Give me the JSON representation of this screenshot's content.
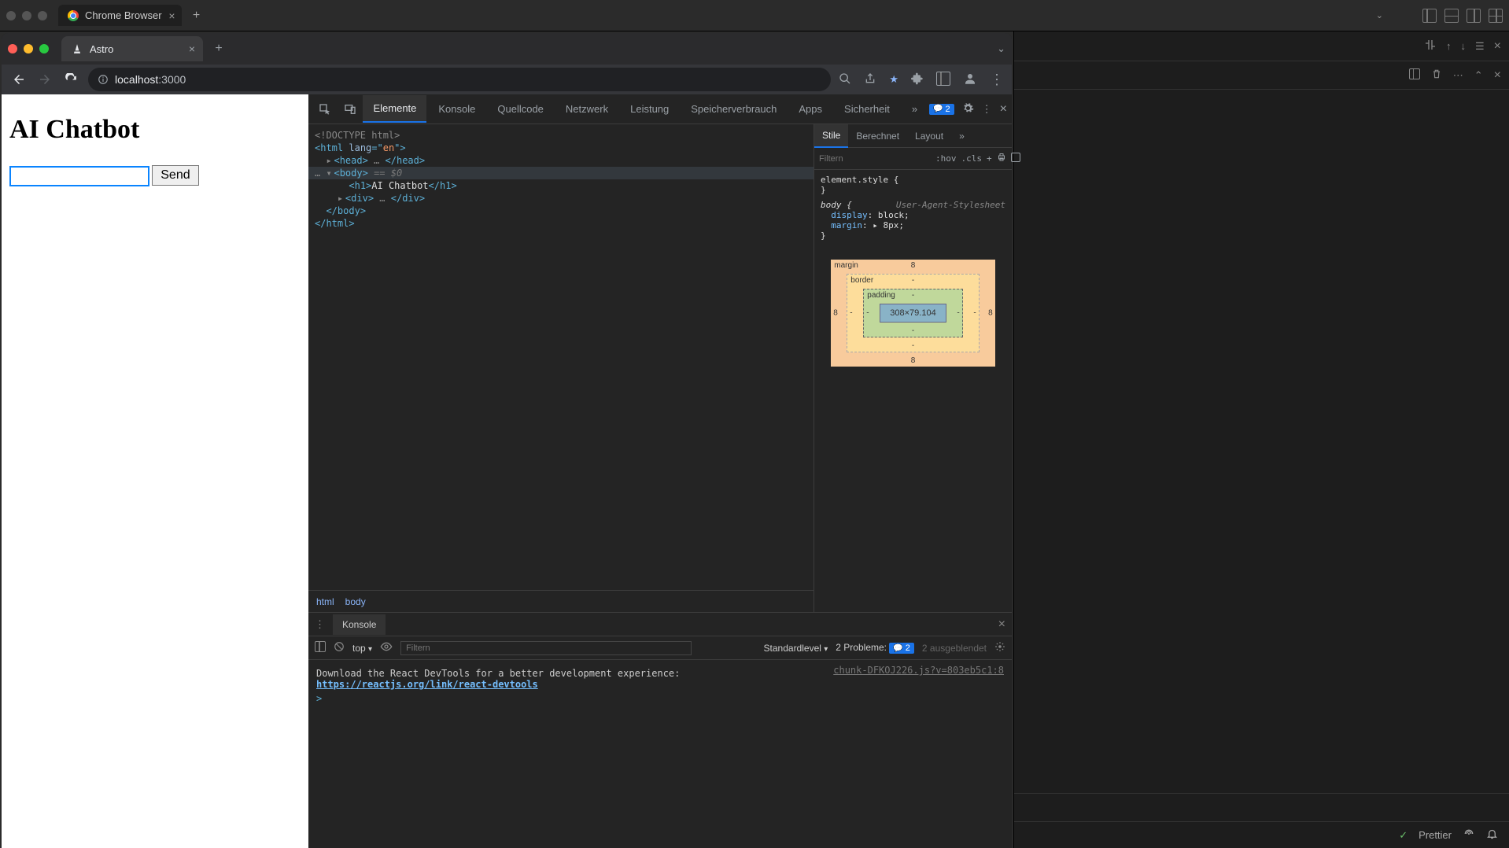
{
  "outer": {
    "tab_title": "Chrome Browser",
    "new_tab": "+",
    "dropdown": "⌄"
  },
  "chrome": {
    "tab_title": "Astro",
    "new_tab": "+",
    "url_host": "localhost",
    "url_path": ":3000"
  },
  "page": {
    "heading": "AI Chatbot",
    "input_value": "",
    "send_button": "Send"
  },
  "devtools": {
    "tabs": [
      "Elemente",
      "Konsole",
      "Quellcode",
      "Netzwerk",
      "Leistung",
      "Speicherverbrauch",
      "Apps",
      "Sicherheit"
    ],
    "more": "»",
    "issues_badge": "2",
    "dom": {
      "l1": "<!DOCTYPE html>",
      "l2a": "<",
      "l2b": "html",
      "l2c": " lang",
      "l2d": "=\"",
      "l2e": "en",
      "l2f": "\">",
      "l3a": "<",
      "l3b": "head",
      "l3c": ">",
      "l3d": " … ",
      "l3e": "</",
      "l3f": "head",
      "l3g": ">",
      "l4a": "<",
      "l4b": "body",
      "l4c": ">",
      "l4d": " == $0",
      "l5a": "<",
      "l5b": "h1",
      "l5c": ">",
      "l5d": "AI Chatbot",
      "l5e": "</",
      "l5f": "h1",
      "l5g": ">",
      "l6a": "<",
      "l6b": "div",
      "l6c": ">",
      "l6d": " … ",
      "l6e": "</",
      "l6f": "div",
      "l6g": ">",
      "l7a": "</",
      "l7b": "body",
      "l7c": ">",
      "l8a": "</",
      "l8b": "html",
      "l8c": ">"
    },
    "crumbs": [
      "html",
      "body"
    ],
    "styles": {
      "tabs": [
        "Stile",
        "Berechnet",
        "Layout"
      ],
      "filter_placeholder": "Filtern",
      "hov": ":hov",
      "cls": ".cls",
      "rule1_sel": "element.style {",
      "rule1_close": "}",
      "rule2_sel": "body {",
      "rule2_meta": "User-Agent-Stylesheet",
      "rule2_p1_name": "display",
      "rule2_p1_val": "block",
      "rule2_p2_name": "margin",
      "rule2_p2_val": "8px",
      "rule2_close": "}"
    },
    "box_model": {
      "margin_label": "margin",
      "border_label": "border",
      "padding_label": "padding",
      "content": "308×79.104",
      "margin_val": "8",
      "border_val": "-",
      "padding_val": "-"
    },
    "console": {
      "tab": "Konsole",
      "context": "top",
      "filter_placeholder": "Filtern",
      "level": "Standardlevel",
      "problems_label": "2 Probleme:",
      "problems_count": "2",
      "hidden": "2 ausgeblendet",
      "msg1_text": "Download the React DevTools for a better development experience: ",
      "msg1_link": "https://reactjs.org/link/react-devtools",
      "msg1_src": "chunk-DFKOJ226.js?v=803eb5c1:8",
      "prompt": ">"
    }
  },
  "editor_side": {
    "prettier": "Prettier"
  }
}
